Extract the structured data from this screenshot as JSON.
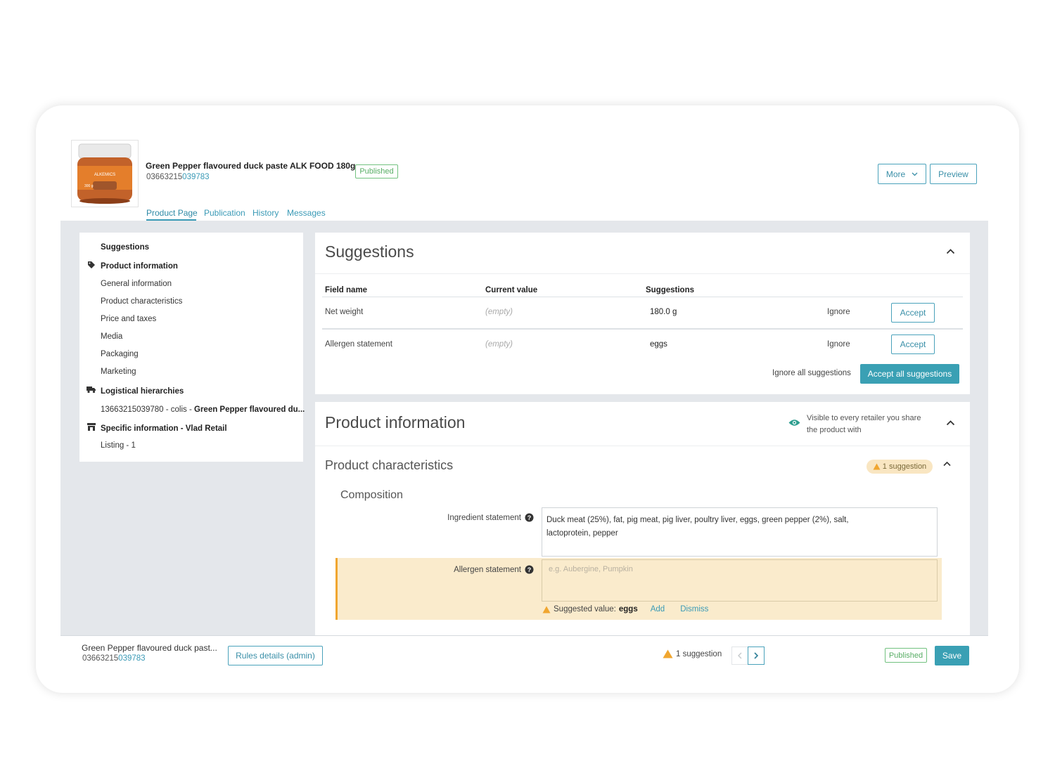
{
  "product": {
    "title": "Green Pepper flavoured duck paste ALK FOOD 180g",
    "gtin_prefix": "03663215",
    "gtin_suffix": "039783",
    "status": "Published",
    "image_label": "ALKEMICS",
    "image_weight": "300 g"
  },
  "header": {
    "more_label": "More",
    "preview_label": "Preview"
  },
  "tabs": [
    "Product Page",
    "Publication",
    "History",
    "Messages"
  ],
  "sidebar": {
    "items": [
      {
        "label": "Suggestions"
      },
      {
        "label": "Product information",
        "icon": "tag-icon"
      },
      {
        "label": "General information"
      },
      {
        "label": "Product characteristics"
      },
      {
        "label": "Price and taxes"
      },
      {
        "label": "Media"
      },
      {
        "label": "Packaging"
      },
      {
        "label": "Marketing"
      },
      {
        "label": "Logistical hierarchies",
        "icon": "truck-icon"
      },
      {
        "label_code": "13663215039780 - colis - ",
        "label_bold": "Green Pepper flavoured du..."
      },
      {
        "label": "Specific information - Vlad Retail",
        "icon": "store-icon"
      },
      {
        "label": "Listing - 1"
      }
    ]
  },
  "suggestions": {
    "title": "Suggestions",
    "columns": [
      "Field name",
      "Current value",
      "Suggestions"
    ],
    "rows": [
      {
        "field": "Net weight",
        "current": "(empty)",
        "suggestion": "180.0 g",
        "ignore": "Ignore",
        "accept": "Accept"
      },
      {
        "field": "Allergen statement",
        "current": "(empty)",
        "suggestion": "eggs",
        "ignore": "Ignore",
        "accept": "Accept"
      }
    ],
    "ignore_all": "Ignore all suggestions",
    "accept_all": "Accept all suggestions"
  },
  "product_info": {
    "title": "Product information",
    "visibility_note_line1": "Visible to every retailer you share",
    "visibility_note_line2": "the product with",
    "section_title": "Product characteristics",
    "suggestion_badge": "1 suggestion",
    "subsection": "Composition",
    "ingredient_label": "Ingredient statement",
    "ingredient_value_line1": "Duck meat (25%), fat, pig meat, pig liver, poultry liver, eggs, green pepper (2%), salt,",
    "ingredient_value_line2": "lactoprotein, pepper",
    "allergen_label": "Allergen statement",
    "allergen_placeholder": "e.g. Aubergine, Pumpkin",
    "suggested_prefix": "Suggested value:",
    "suggested_value": "eggs",
    "add_label": "Add",
    "dismiss_label": "Dismiss"
  },
  "footer": {
    "title": "Green Pepper flavoured duck past...",
    "gtin_prefix": "03663215",
    "gtin_suffix": "039783",
    "rules_button": "Rules details (admin)",
    "suggestion_count": "1 suggestion",
    "status": "Published",
    "save_label": "Save"
  },
  "colors": {
    "accent": "#3aa0b4",
    "published": "#57ad64",
    "warning": "#f0a630",
    "highlight": "#faebcc"
  }
}
